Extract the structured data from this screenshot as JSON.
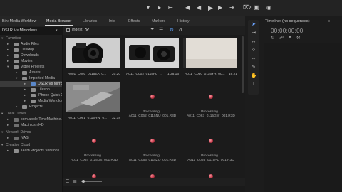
{
  "topbar": {
    "icons": [
      "mark-in-icon",
      "mark-out-icon",
      "go-to-in-icon",
      "step-back-icon",
      "play-icon",
      "step-forward-icon",
      "go-to-out-icon",
      "insert-icon",
      "overwrite-icon",
      "export-frame-icon",
      "add-icon"
    ]
  },
  "bin_panel": {
    "tab_label": "Bin: Media Workflow"
  },
  "media_browser": {
    "tabs": [
      {
        "label": "Media Browser",
        "active": true
      },
      {
        "label": "Libraries"
      },
      {
        "label": "Info"
      },
      {
        "label": "Effects"
      },
      {
        "label": "Markers"
      },
      {
        "label": "History"
      }
    ],
    "tree": {
      "selector": "DSLR Vs Mirrorless",
      "rows": [
        {
          "label": "Favorites",
          "kind": "section"
        },
        {
          "label": "Audio Files"
        },
        {
          "label": "Desktop"
        },
        {
          "label": "Downloads"
        },
        {
          "label": "Movies"
        },
        {
          "label": "Video Projects"
        },
        {
          "label": "Assets"
        },
        {
          "label": "Imported Media"
        },
        {
          "label": "DSLR Vs Mirrorle"
        },
        {
          "label": "Lifeson"
        },
        {
          "label": "iPhone Quick Che"
        },
        {
          "label": "Media Workflow"
        },
        {
          "label": "Projects"
        },
        {
          "label": "Local Drives",
          "kind": "section"
        },
        {
          "label": "com.apple.TimeMachine.lo"
        },
        {
          "label": "Macintosh HD"
        },
        {
          "label": "Network Drives",
          "kind": "section"
        },
        {
          "label": "NAS"
        },
        {
          "label": "Creative Cloud",
          "kind": "section"
        },
        {
          "label": "Team Projects Versions"
        }
      ]
    },
    "toolbar": {
      "ingest_label": "Ingest"
    },
    "clips": [
      {
        "name": "A001_C001_0115EA_0...",
        "duration": "20:20",
        "state": "thumb"
      },
      {
        "name": "A011_C002_0115FU_...",
        "duration": "1:36:16",
        "state": "thumb"
      },
      {
        "name": "A011_C060_0115YR_00...",
        "duration": "16:21",
        "state": "thumb"
      },
      {
        "name": "A011_C061_0115RW_0...",
        "duration": "32:18",
        "state": "thumb"
      },
      {
        "status": "Processing...",
        "name": "A011_C062_0115NU_001.R3D",
        "state": "processing"
      },
      {
        "status": "Processing...",
        "name": "A011_C063_0115GW_001.R3D",
        "state": "processing"
      },
      {
        "status": "Processing...",
        "name": "A011_C064_0115DS_001.R3D",
        "state": "processing"
      },
      {
        "status": "Processing...",
        "name": "A011_C065_0115ZQ_001.R3D",
        "state": "processing"
      },
      {
        "status": "Processing...",
        "name": "A011_C066_0115PL_001.R3D",
        "state": "processing"
      }
    ]
  },
  "timeline": {
    "tab_label": "Timeline: (no sequences)",
    "timecode": "00;00;00;00"
  },
  "colors": {
    "accent": "#5b88c9",
    "processing_dot": "#c33a4a"
  }
}
